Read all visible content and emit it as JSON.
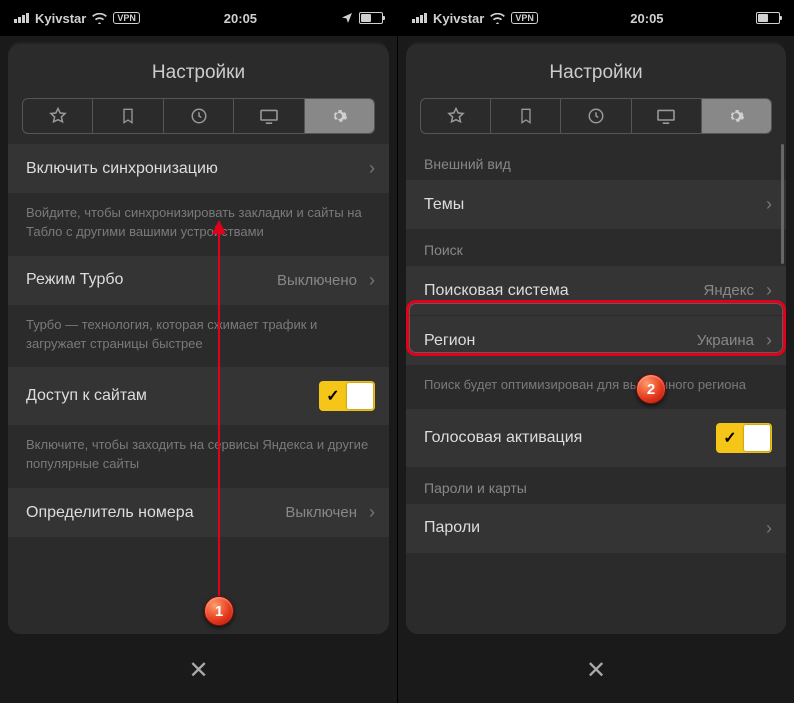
{
  "status": {
    "carrier": "Kyivstar",
    "time": "20:05",
    "vpn": "VPN"
  },
  "left": {
    "title": "Настройки",
    "rows": {
      "sync": {
        "label": "Включить синхронизацию"
      },
      "sync_desc": "Войдите, чтобы синхронизировать закладки и сайты на Табло с другими вашими устройствами",
      "turbo": {
        "label": "Режим Турбо",
        "value": "Выключено"
      },
      "turbo_desc": "Турбо — технология, которая сжимает трафик и загружает страницы быстрее",
      "access": {
        "label": "Доступ к сайтам"
      },
      "access_desc": "Включите, чтобы заходить на сервисы Яндекса и другие популярные сайты",
      "callerid": {
        "label": "Определитель номера",
        "value": "Выключен"
      }
    }
  },
  "right": {
    "title": "Настройки",
    "sections": {
      "appearance": "Внешний вид",
      "search": "Поиск",
      "passwords": "Пароли и карты"
    },
    "rows": {
      "themes": {
        "label": "Темы"
      },
      "search_engine": {
        "label": "Поисковая система",
        "value": "Яндекс"
      },
      "region": {
        "label": "Регион",
        "value": "Украина"
      },
      "region_desc": "Поиск будет оптимизирован для выбранного региона",
      "voice": {
        "label": "Голосовая активация"
      },
      "passwords": {
        "label": "Пароли"
      }
    }
  },
  "annotations": {
    "badge1": "1",
    "badge2": "2"
  }
}
